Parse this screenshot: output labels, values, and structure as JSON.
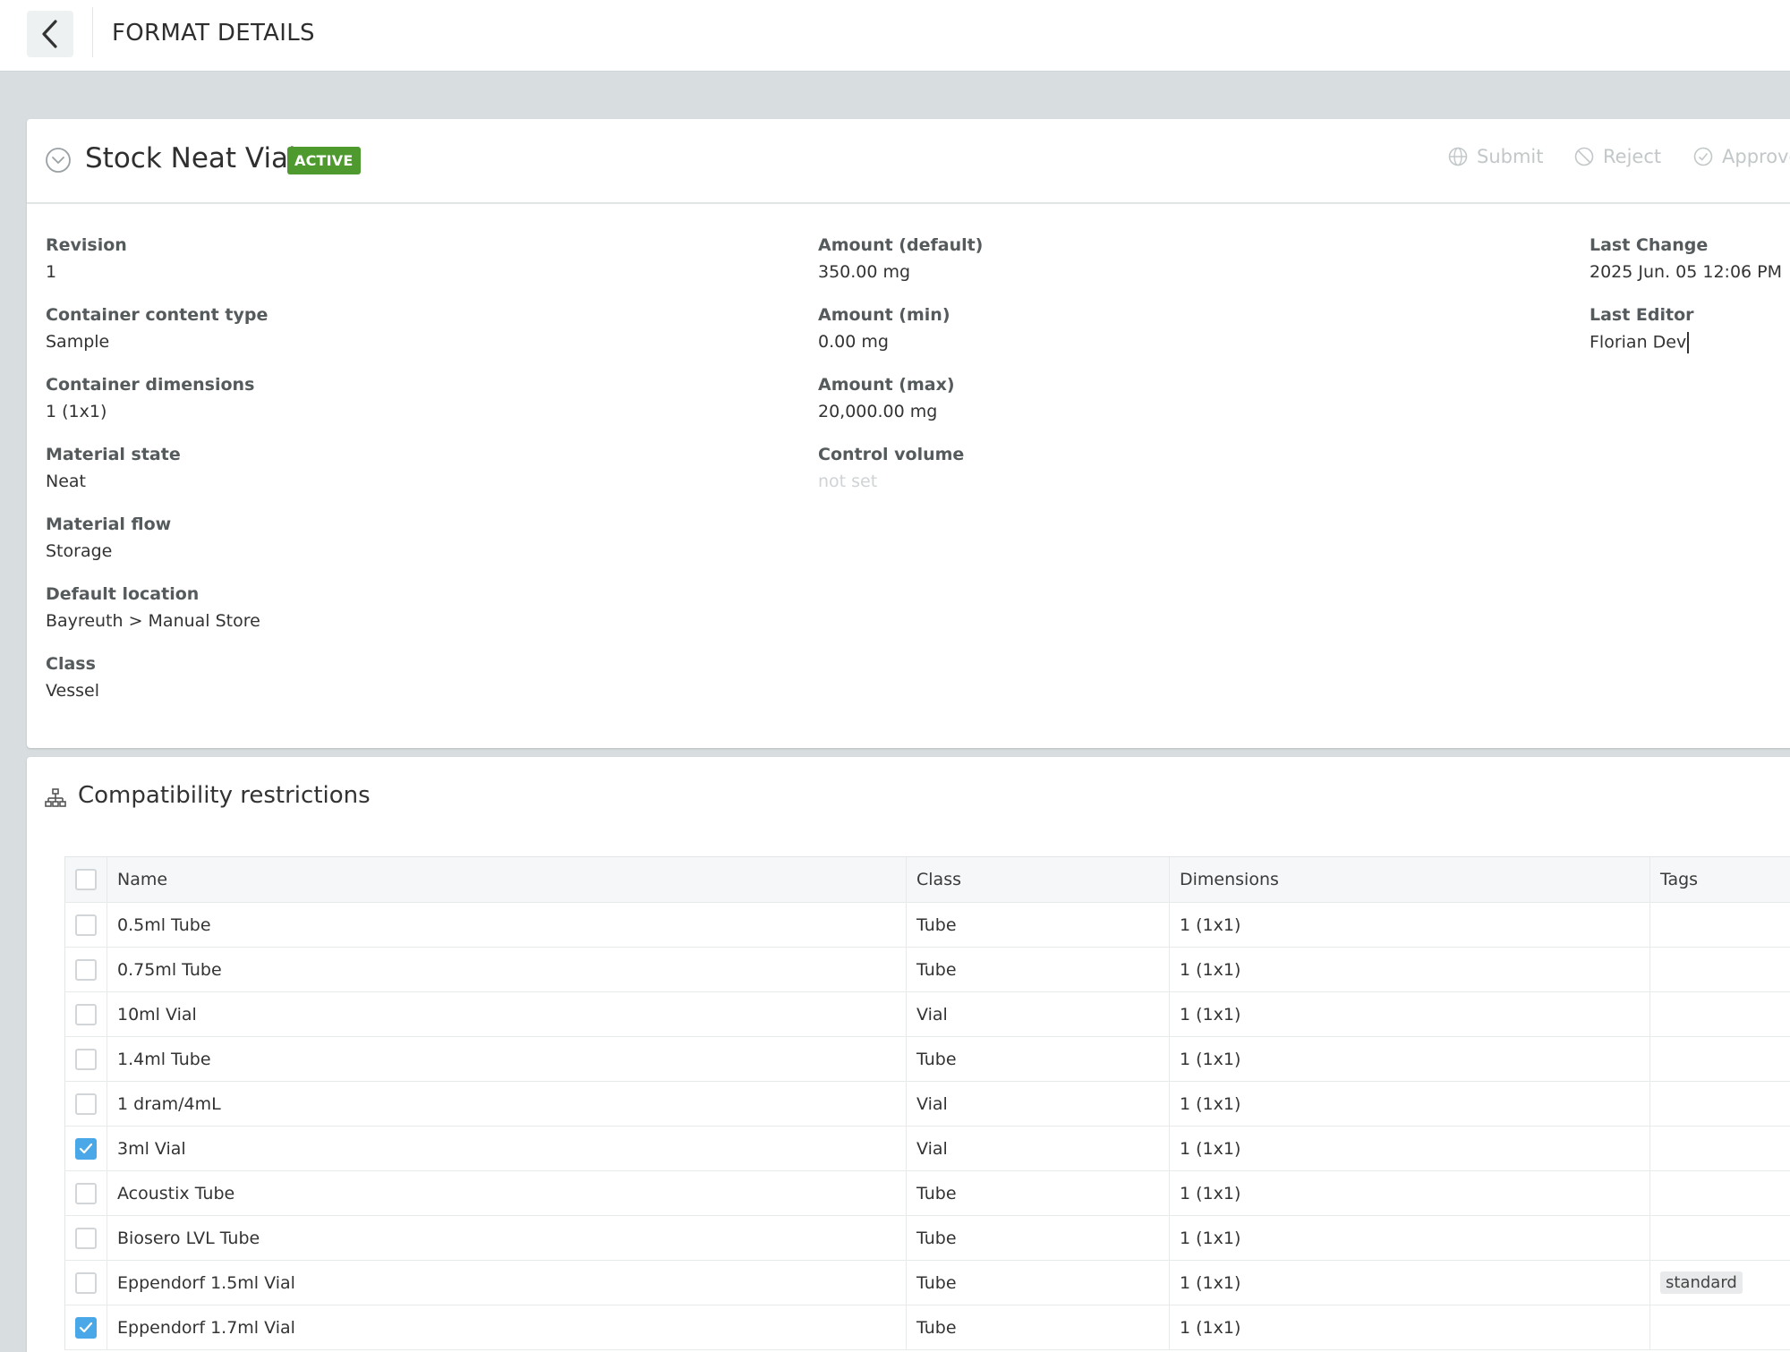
{
  "header": {
    "title": "FORMAT DETAILS",
    "back_icon": "chevron-left-icon"
  },
  "format": {
    "name": "Stock Neat Vial",
    "status": "ACTIVE",
    "status_color": "#4e9a2f",
    "actions": {
      "submit": "Submit",
      "reject": "Reject",
      "approve": "Approve"
    }
  },
  "details": {
    "revision": {
      "label": "Revision",
      "value": "1"
    },
    "content_type": {
      "label": "Container content type",
      "value": "Sample"
    },
    "dimensions": {
      "label": "Container dimensions",
      "value": "1 (1x1)"
    },
    "material_state": {
      "label": "Material state",
      "value": "Neat"
    },
    "material_flow": {
      "label": "Material flow",
      "value": "Storage"
    },
    "default_location": {
      "label": "Default location",
      "value": "Bayreuth > Manual Store"
    },
    "class": {
      "label": "Class",
      "value": "Vessel"
    },
    "amount_default": {
      "label": "Amount (default)",
      "value": "350.00 mg"
    },
    "amount_min": {
      "label": "Amount (min)",
      "value": "0.00 mg"
    },
    "amount_max": {
      "label": "Amount (max)",
      "value": "20,000.00 mg"
    },
    "control_volume": {
      "label": "Control volume",
      "value": "not set"
    },
    "last_change": {
      "label": "Last Change",
      "value": "2025 Jun. 05 12:06 PM"
    },
    "last_editor": {
      "label": "Last Editor",
      "value": "Florian Dev"
    }
  },
  "compat": {
    "title": "Compatibility restrictions",
    "columns": {
      "name": "Name",
      "class": "Class",
      "dimensions": "Dimensions",
      "tags": "Tags"
    },
    "rows": [
      {
        "name": "0.5ml Tube",
        "class": "Tube",
        "dimensions": "1 (1x1)",
        "tag": "",
        "checked": false
      },
      {
        "name": "0.75ml Tube",
        "class": "Tube",
        "dimensions": "1 (1x1)",
        "tag": "",
        "checked": false
      },
      {
        "name": "10ml Vial",
        "class": "Vial",
        "dimensions": "1 (1x1)",
        "tag": "",
        "checked": false
      },
      {
        "name": "1.4ml Tube",
        "class": "Tube",
        "dimensions": "1 (1x1)",
        "tag": "",
        "checked": false
      },
      {
        "name": "1 dram/4mL",
        "class": "Vial",
        "dimensions": "1 (1x1)",
        "tag": "",
        "checked": false
      },
      {
        "name": "3ml Vial",
        "class": "Vial",
        "dimensions": "1 (1x1)",
        "tag": "",
        "checked": true
      },
      {
        "name": "Acoustix Tube",
        "class": "Tube",
        "dimensions": "1 (1x1)",
        "tag": "",
        "checked": false
      },
      {
        "name": "Biosero LVL Tube",
        "class": "Tube",
        "dimensions": "1 (1x1)",
        "tag": "",
        "checked": false
      },
      {
        "name": "Eppendorf 1.5ml Vial",
        "class": "Tube",
        "dimensions": "1 (1x1)",
        "tag": "standard",
        "checked": false
      },
      {
        "name": "Eppendorf 1.7ml Vial",
        "class": "Tube",
        "dimensions": "1 (1x1)",
        "tag": "",
        "checked": true
      }
    ]
  }
}
